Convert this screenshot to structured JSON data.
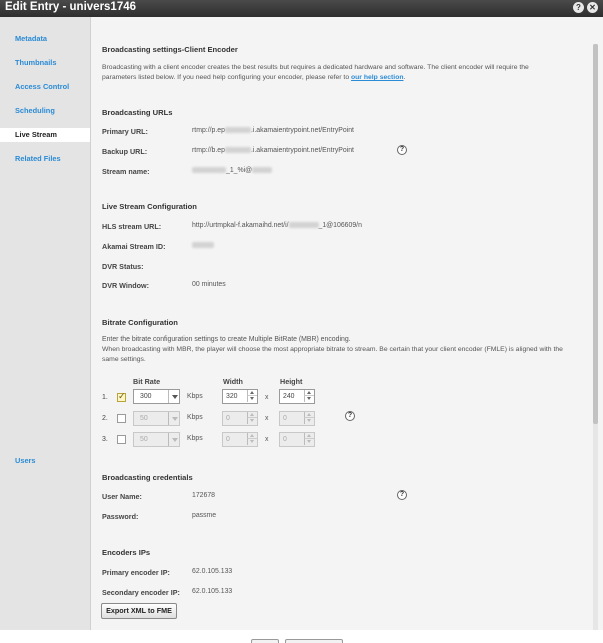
{
  "window": {
    "title": "Edit Entry - univers1746",
    "help_glyph": "?",
    "close_glyph": "✕"
  },
  "sidebar": {
    "items": [
      {
        "label": "Metadata"
      },
      {
        "label": "Thumbnails"
      },
      {
        "label": "Access Control"
      },
      {
        "label": "Scheduling"
      },
      {
        "label": "Live Stream",
        "active": true
      },
      {
        "label": "Related Files"
      },
      {
        "label": "Users"
      }
    ]
  },
  "encoder": {
    "heading": "Broadcasting settings-Client Encoder",
    "description": "Broadcasting with a client encoder creates the best results but requires a dedicated hardware and software. The client encoder will require the parameters listed below. If you need help configuring your encoder, please refer to ",
    "help_link": "our help section",
    "period": "."
  },
  "urls": {
    "heading": "Broadcasting URLs",
    "primary_label": "Primary URL:",
    "primary_prefix": "rtmp://p.ep",
    "primary_suffix": ".i.akamaientrypoint.net/EntryPoint",
    "backup_label": "Backup URL:",
    "backup_prefix": "rtmp://b.ep",
    "backup_suffix": ".i.akamaientrypoint.net/EntryPoint",
    "stream_label": "Stream name:",
    "stream_value": "_1_%i@"
  },
  "live": {
    "heading": "Live Stream Configuration",
    "hls_label": "HLS stream URL:",
    "hls_prefix": "http://urtmpkal-f.akamaihd.net/i/",
    "hls_suffix": "_1@106609/n",
    "akamai_label": "Akamai Stream ID:",
    "dvr_status_label": "DVR Status:",
    "dvr_window_label": "DVR Window:",
    "dvr_window_value": "00 minutes"
  },
  "bitrate": {
    "heading": "Bitrate Configuration",
    "intro_1": "Enter the bitrate configuration settings to create Multiple BitRate (MBR) encoding.",
    "intro_2": "When broadcasting with MBR, the player will choose the most appropriate bitrate to stream. Be certain that your client encoder (FMLE) is aligned with the same settings.",
    "col_bitrate": "Bit Rate",
    "col_width": "Width",
    "col_height": "Height",
    "unit": "Kbps",
    "times": "x",
    "rows": [
      {
        "num": "1.",
        "checked": true,
        "bitrate": "300",
        "width": "320",
        "height": "240"
      },
      {
        "num": "2.",
        "checked": false,
        "bitrate": "50",
        "width": "0",
        "height": "0"
      },
      {
        "num": "3.",
        "checked": false,
        "bitrate": "50",
        "width": "0",
        "height": "0"
      }
    ]
  },
  "credentials": {
    "heading": "Broadcasting credentials",
    "user_label": "User Name:",
    "user_value": "172678",
    "password_label": "Password:",
    "password_value": "passme"
  },
  "ips": {
    "heading": "Encoders IPs",
    "primary_label": "Primary encoder IP:",
    "primary_value": "62.0.105.133",
    "secondary_label": "Secondary encoder IP:",
    "secondary_value": "62.0.105.133",
    "export_button": "Export XML to FME"
  },
  "colors": {
    "accent": "#2a8bd6",
    "titlebar": "#3a3a3a",
    "sidebar": "#e4e4e4",
    "panel": "#f4f4f4"
  }
}
